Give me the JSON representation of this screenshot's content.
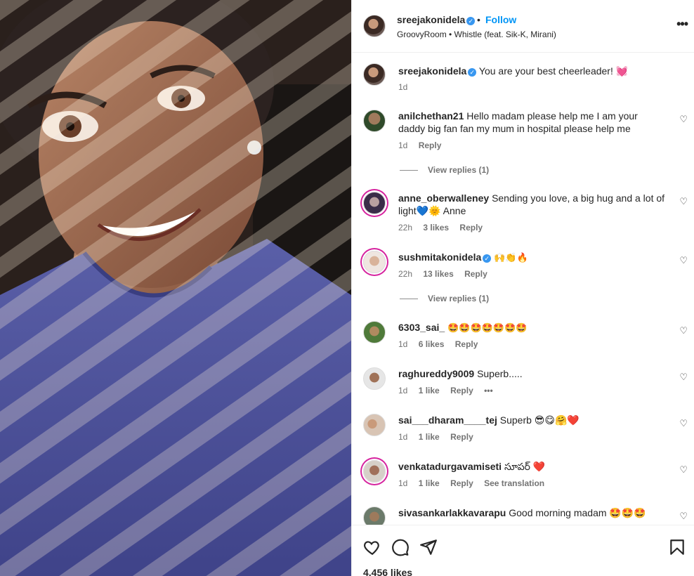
{
  "post": {
    "username": "sreejakonidela",
    "follow_label": "Follow",
    "separator": "•",
    "audio": "GroovyRoom • Whistle (feat. Sik-K, Mirani)",
    "more_label": "•••"
  },
  "caption": {
    "username": "sreejakonidela",
    "text": "You are your best cheerleader! 💓",
    "time": "1d"
  },
  "comments": [
    {
      "username": "anilchethan21",
      "text": "Hello madam please help me I am your daddy big fan fan my mum in hospital please help me",
      "time": "1d",
      "likes": "",
      "reply": "Reply",
      "view_replies": "View replies (1)"
    },
    {
      "username": "anne_oberwalleney",
      "text": "Sending you love, a big hug and a lot of light💙🌞 Anne",
      "time": "22h",
      "likes": "3 likes",
      "reply": "Reply",
      "view_replies": ""
    },
    {
      "username": "sushmitakonidela",
      "text": "🙌👏🔥",
      "time": "22h",
      "likes": "13 likes",
      "reply": "Reply",
      "view_replies": "View replies (1)"
    },
    {
      "username": "6303_sai_",
      "text": "🤩🤩🤩🤩🤩🤩🤩",
      "time": "1d",
      "likes": "6 likes",
      "reply": "Reply",
      "view_replies": ""
    },
    {
      "username": "raghureddy9009",
      "text": "Superb.....",
      "time": "1d",
      "likes": "1 like",
      "reply": "Reply",
      "extra": "•••"
    },
    {
      "username": "sai___dharam____tej",
      "text": "Superb 😎😋🤗❤️",
      "time": "1d",
      "likes": "1 like",
      "reply": "Reply"
    },
    {
      "username": "venkatadurgavamiseti",
      "text": "సూపర్ ❤️",
      "time": "1d",
      "likes": "1 like",
      "reply": "Reply",
      "extra": "See translation"
    },
    {
      "username": "sivasankarlakkavarapu",
      "text": "Good morning madam 🤩🤩🤩",
      "time": "",
      "likes": "",
      "reply": ""
    }
  ],
  "footer": {
    "likes": "4,456 likes",
    "icons": [
      "heart-icon",
      "comment-icon",
      "share-icon",
      "bookmark-icon"
    ]
  }
}
